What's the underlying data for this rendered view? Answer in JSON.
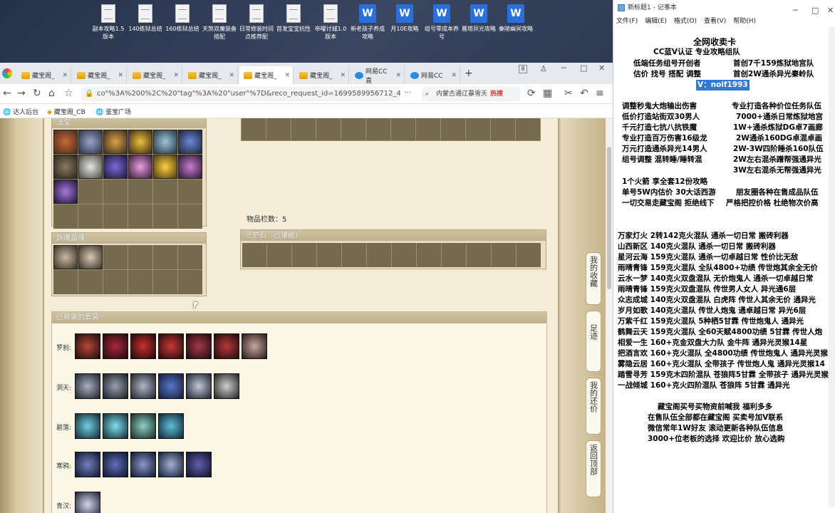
{
  "desktop": {
    "icons": [
      {
        "label": "副本攻略1.5版本",
        "type": "doc"
      },
      {
        "label": "140练狱总结",
        "type": "doc"
      },
      {
        "label": "160练狱总结",
        "type": "doc"
      },
      {
        "label": "天煞双魔装备搭配",
        "type": "doc"
      },
      {
        "label": "日常修装时间点推荐配",
        "type": "doc"
      },
      {
        "label": "首发宝宝抗性",
        "type": "doc"
      },
      {
        "label": "帝曜讨城1.0版本",
        "type": "doc"
      },
      {
        "label": "新老孩子养成攻略",
        "type": "wps"
      },
      {
        "label": "月10E攻略",
        "type": "wps"
      },
      {
        "label": "组号零成本养号",
        "type": "wps"
      },
      {
        "label": "雁塔异光攻略",
        "type": "wps"
      },
      {
        "label": "秦陵幽冥攻略",
        "type": "wps"
      }
    ]
  },
  "browser": {
    "tabs": [
      {
        "label": "藏宝阁_",
        "active": false
      },
      {
        "label": "藏宝阁_",
        "active": false
      },
      {
        "label": "藏宝阁_",
        "active": false
      },
      {
        "label": "藏宝阁_",
        "active": false
      },
      {
        "label": "藏宝阁_",
        "active": true
      },
      {
        "label": "藏宝阁_",
        "active": false
      },
      {
        "label": "网易CC直",
        "active": false
      },
      {
        "label": "网易CC",
        "active": false
      }
    ],
    "tab_count": "8",
    "url": "co\"%3A%200%2C%20\"tag\"%3A%20\"user\"%7D&reco_request_id=1699589956712_44ke",
    "search_text": "内蒙古通辽暴雪天",
    "search_hot": "热搜",
    "bookmarks": [
      "达人后台",
      "藏宝阁_CB",
      "鉴宝广场"
    ]
  },
  "game": {
    "panel_fabao_title": "法宝",
    "panel_jingmai_title": "妖魄晶魂",
    "panel_shouhu_title": "守护石（已镶嵌）",
    "item_count": "物品栏数：5",
    "collected_title": "已收录的套装",
    "sets": [
      {
        "label": "罗刹:",
        "count": 7
      },
      {
        "label": "洞天:",
        "count": 6
      },
      {
        "label": "碧落:",
        "count": 4
      },
      {
        "label": "寒鸦:",
        "count": 5
      },
      {
        "label": "青汉:",
        "count": 1
      }
    ],
    "side_buttons": [
      "我的收藏",
      "足迹",
      "我的还价",
      "返回顶部"
    ]
  },
  "notepad": {
    "title": "新标题1 - 记事本",
    "menu": [
      "文件(F)",
      "编辑(E)",
      "格式(O)",
      "查看(V)",
      "帮助(H)"
    ],
    "lines": [
      "全网收卖卡",
      "CC蓝V认证 专业攻略组队",
      "低端任务组号开创者",
      "首创7千159炼狱地宫队",
      "估价 找号 搭配 调整",
      "首创2W通杀异光秦岭队",
      "V：noif1993",
      "调整秒鬼大炮输出伤害",
      "专业打造各种价位任务队伍",
      "低价打造站街双30男人",
      "7000+通杀日常炼狱地宫",
      "千元打造七抗八抗铁魔",
      "1W+通杀炼狱DG卓7画廊",
      "专业打造百万伤害16级龙",
      "2W通杀160DG卓混卓画",
      "万元打造通杀异光14男人",
      "2W-3W四阶睡杀160队伍",
      "组号调整 混转睡/睡转混",
      "2W左右混杀蹭帮强通异光",
      "3W左右混杀无帮强通异光",
      "1个火箭 享全套12份攻略",
      "单号5W内估价 30大话西游",
      "朋友圈各种在售成品队伍",
      "一切交易走藏宝阁 拒绝线下",
      "严格把控价格 杜绝物次价高",
      "万家灯火 2转142克火混队 通杀一切日常 搬砖利器",
      "山西新区 140克火混队 通杀一切日常 搬砖利器",
      "星河云海 159克火混队 通杀一切卓越日常 性价比无敌",
      "雨晴青锋 159克火混队 全队4800+功绩 传世炮其余全无价",
      "云水一梦 140克火双盘混队 无价炮鬼人 通杀一切卓越日常",
      "雨晴青锋 159克火双盘混队 传世男人女人 异光通6层",
      "众志成城 140克火双盘混队 白虎阵 传世人其余无价 通异光",
      "岁月如歌 140克火混队 传世人炮鬼 通卓越日常 异光6层",
      "万紫千红 159克火混队 5种栖5甘霖 传世炮鬼人 通异光",
      "鹤舞云天 159克火混队 全60天赋4800功绩 5甘霖 传世人炮",
      "相爱一生 160+克金双盘大力队 金牛阵 通异光灵猴14星",
      "把酒言欢 160+克火混队 全4800功绩 传世炮鬼人 通异光灵猴",
      "雾隐云居 160+克火混队 全带孩子 传世炮人鬼 通异光灵猴14",
      "踏雪寻芳 159克木四阶混队 苍狼阵5甘霖 全带孩子 通异光灵猴",
      "一战倾城 160+克火四阶混队 苍狼阵 5甘霖 通异光",
      "藏宝阁买号买物资前喊我 福利多多",
      "在售队伍全部都在藏宝阁 买卖号加V联系",
      "微信常年1W好友 滚动更新各种队伍信息",
      "3000+位老板的选择 欢迎比价 放心选购"
    ]
  }
}
